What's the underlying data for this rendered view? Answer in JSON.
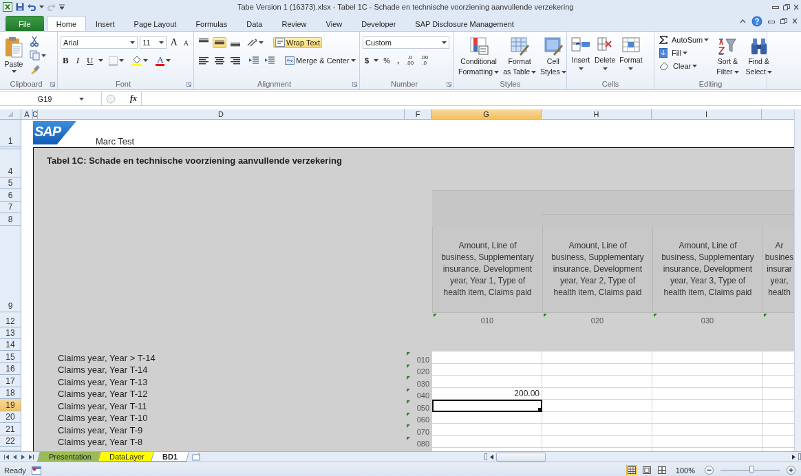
{
  "window": {
    "title": "Tabe Version 1 (16373).xlsx - Tabel 1C - Schade en technische voorziening aanvullende verzekering"
  },
  "quick_access": {
    "redo_disabled": true
  },
  "ribbon": {
    "tabs": [
      {
        "label": "File",
        "kind": "backstage",
        "selected": false
      },
      {
        "label": "Home",
        "kind": "tab",
        "selected": true
      },
      {
        "label": "Insert",
        "kind": "tab",
        "selected": false
      },
      {
        "label": "Page Layout",
        "kind": "tab",
        "selected": false
      },
      {
        "label": "Formulas",
        "kind": "tab",
        "selected": false
      },
      {
        "label": "Data",
        "kind": "tab",
        "selected": false
      },
      {
        "label": "Review",
        "kind": "tab",
        "selected": false
      },
      {
        "label": "View",
        "kind": "tab",
        "selected": false
      },
      {
        "label": "Developer",
        "kind": "tab",
        "selected": false
      },
      {
        "label": "SAP Disclosure Management",
        "kind": "tab",
        "selected": false
      }
    ],
    "clipboard": {
      "paste": "Paste",
      "label": "Clipboard"
    },
    "font": {
      "family": "Arial",
      "size": "11",
      "grow": "A",
      "shrink": "A",
      "bold": "B",
      "italic": "I",
      "underline": "U",
      "font_color": "A",
      "label": "Font"
    },
    "alignment": {
      "vertical": [
        {
          "selected": false
        },
        {
          "selected": true
        },
        {
          "selected": false
        }
      ],
      "wrap_text": {
        "label": "Wrap Text",
        "on": true
      },
      "merge": "Merge & Center",
      "label": "Alignment"
    },
    "number": {
      "format": "Custom",
      "currency": "$",
      "percent": "%",
      "comma": ",",
      "decimals": [
        {
          "top": ".0",
          "bottom": ".00"
        },
        {
          "top": ".00",
          "bottom": ".0"
        }
      ],
      "label": "Number"
    },
    "styles": {
      "buttons": [
        {
          "lines": [
            "Conditional",
            "Formatting"
          ]
        },
        {
          "lines": [
            "Format",
            "as Table"
          ]
        },
        {
          "lines": [
            "Cell",
            "Styles"
          ]
        }
      ],
      "label": "Styles"
    },
    "cells": {
      "buttons": [
        "Insert",
        "Delete",
        "Format"
      ],
      "label": "Cells"
    },
    "editing": {
      "autosum": "AutoSum",
      "fill": "Fill",
      "clear": "Clear",
      "big": [
        {
          "lines": [
            "Sort &",
            "Filter"
          ]
        },
        {
          "lines": [
            "Find &",
            "Select"
          ]
        }
      ],
      "label": "Editing"
    }
  },
  "formula_bar": {
    "name_box": "G19",
    "fx": "fx"
  },
  "sheet": {
    "columns": [
      {
        "label": "A",
        "selected": false
      },
      {
        "label": "C",
        "selected": false
      },
      {
        "label": "D",
        "selected": false
      },
      {
        "label": "F",
        "selected": false
      },
      {
        "label": "G",
        "selected": true
      },
      {
        "label": "H",
        "selected": false
      },
      {
        "label": "I",
        "selected": false
      },
      {
        "selected": false
      }
    ],
    "logo": "SAP",
    "author": "Marc Test",
    "table_title": "Tabel 1C: Schade en technische voorziening aanvullende verzekering",
    "header_rows": [
      {
        "number": "1",
        "selected": false
      },
      {
        "number": "4",
        "selected": false
      },
      {
        "number": "5",
        "selected": false
      },
      {
        "number": "6",
        "selected": false
      },
      {
        "number": "7",
        "selected": false
      },
      {
        "number": "8",
        "selected": false
      },
      {
        "number": "9",
        "selected": false
      },
      {
        "number": "12",
        "selected": false
      },
      {
        "number": "13",
        "selected": false
      },
      {
        "number": "14",
        "selected": false
      }
    ],
    "column_headings": [
      {
        "lines": [
          "Amount, Line of",
          "business, Supplementary",
          "insurance, Development",
          "year, Year 1, Type of",
          "health item, Claims paid"
        ]
      },
      {
        "lines": [
          "Amount, Line of",
          "business, Supplementary",
          "insurance, Development",
          "year, Year 2, Type of",
          "health item, Claims paid"
        ]
      },
      {
        "lines": [
          "Amount, Line of",
          "business, Supplementary",
          "insurance, Development",
          "year, Year 3, Type of",
          "health item, Claims paid"
        ]
      },
      {
        "lines": [
          "Ar",
          "busines",
          "insurar",
          "year,",
          "health"
        ]
      }
    ],
    "column_codes": [
      "010",
      "020",
      "030"
    ],
    "data_rows": [
      {
        "number": "15",
        "label": "Claims year, Year > T-14",
        "code": "010",
        "selected": false
      },
      {
        "number": "16",
        "label": "Claims year, Year T-14",
        "code": "020",
        "selected": false
      },
      {
        "number": "17",
        "label": "Claims year, Year T-13",
        "code": "030",
        "selected": false
      },
      {
        "number": "18",
        "label": "Claims year, Year T-12",
        "code": "040",
        "amount": "200.00",
        "selected": false
      },
      {
        "number": "19",
        "label": "Claims year, Year T-11",
        "code": "050",
        "selected": true
      },
      {
        "number": "20",
        "label": "Claims year, Year T-10",
        "code": "060",
        "selected": false
      },
      {
        "number": "21",
        "label": "Claims year, Year T-9",
        "code": "070",
        "selected": false
      },
      {
        "number": "22",
        "label": "Claims year, Year T-8",
        "code": "080",
        "selected": false
      }
    ]
  },
  "sheet_tabs": [
    {
      "label": "Presentation",
      "color": "#9bbb59",
      "selected": false
    },
    {
      "label": "DataLayer",
      "color": "#ffff00",
      "selected": false
    },
    {
      "label": "BD1",
      "selected": true
    }
  ],
  "status_bar": {
    "status": "Ready",
    "views": [
      {
        "selected": true
      },
      {
        "selected": false
      },
      {
        "selected": false
      }
    ],
    "zoom": "100%",
    "zoom_slider": {
      "level": 0.52
    }
  }
}
